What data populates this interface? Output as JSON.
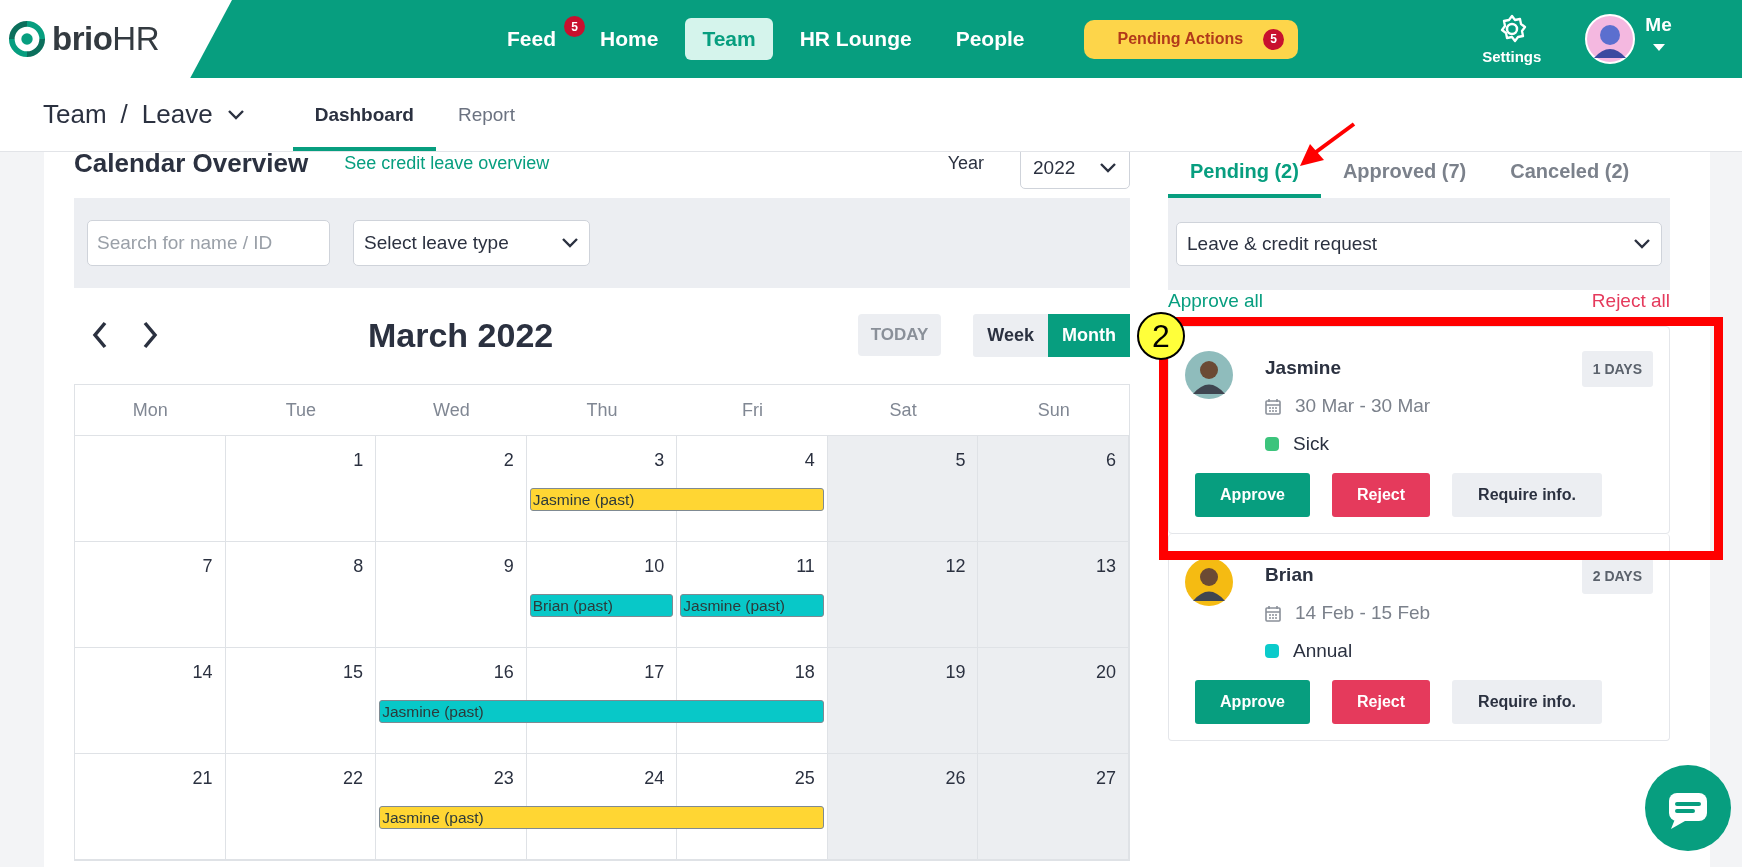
{
  "logo": {
    "text": "**brio**HR"
  },
  "nav": [
    {
      "kind": "link",
      "label": "Feed",
      "selected": false,
      "badge": "5"
    },
    {
      "kind": "link",
      "label": "Home",
      "selected": false
    },
    {
      "kind": "link",
      "label": "Team",
      "selected": true
    },
    {
      "kind": "link",
      "label": "HR Lounge",
      "selected": false
    },
    {
      "kind": "link",
      "label": "People",
      "selected": false
    },
    {
      "kind": "pill",
      "label": "Pending Actions",
      "selected": false,
      "badge": "5"
    }
  ],
  "settings": {
    "label": "Settings"
  },
  "profile": {
    "label": "Me"
  },
  "breadcrumb": {
    "section": "Team",
    "separator": "/",
    "page": "Leave"
  },
  "subtabs": [
    {
      "label": "Dashboard",
      "selected": true
    },
    {
      "label": "Report",
      "selected": false
    }
  ],
  "calendar": {
    "title": "Calendar Overview",
    "link": "See credit leave overview",
    "year_label": "Year",
    "year": "2022",
    "search": {
      "placeholder": "Search for name / ID"
    },
    "leave_type": {
      "value": "Select leave type"
    },
    "month": "March 2022",
    "today": "TODAY",
    "views": [
      {
        "label": "Week",
        "selected": false
      },
      {
        "label": "Month",
        "selected": true
      }
    ],
    "weekdays": [
      "Mon",
      "Tue",
      "Wed",
      "Thu",
      "Fri",
      "Sat",
      "Sun"
    ],
    "weeks": [
      {
        "days": [
          {
            "weekend": false
          },
          {
            "date": "1",
            "weekend": false
          },
          {
            "date": "2",
            "weekend": false
          },
          {
            "date": "3",
            "weekend": false,
            "event": {
              "label": "Jasmine (past)",
              "color": "#ffd633"
            }
          },
          {
            "date": "4",
            "weekend": false,
            "continues": true
          },
          {
            "date": "5",
            "weekend": true
          },
          {
            "date": "6",
            "weekend": true
          }
        ]
      },
      {
        "days": [
          {
            "date": "7",
            "weekend": false
          },
          {
            "date": "8",
            "weekend": false
          },
          {
            "date": "9",
            "weekend": false
          },
          {
            "date": "10",
            "weekend": false,
            "event": {
              "label": "Brian (past)",
              "color": "#08c8c8"
            }
          },
          {
            "date": "11",
            "weekend": false,
            "event": {
              "label": "Jasmine (past)",
              "color": "#08c8c8"
            }
          },
          {
            "date": "12",
            "weekend": true
          },
          {
            "date": "13",
            "weekend": true
          }
        ]
      },
      {
        "days": [
          {
            "date": "14",
            "weekend": false
          },
          {
            "date": "15",
            "weekend": false
          },
          {
            "date": "16",
            "weekend": false,
            "event": {
              "label": "Jasmine (past)",
              "color": "#08c8c8"
            }
          },
          {
            "date": "17",
            "weekend": false,
            "continues": true
          },
          {
            "date": "18",
            "weekend": false,
            "continues": true
          },
          {
            "date": "19",
            "weekend": true
          },
          {
            "date": "20",
            "weekend": true
          }
        ]
      },
      {
        "days": [
          {
            "date": "21",
            "weekend": false
          },
          {
            "date": "22",
            "weekend": false
          },
          {
            "date": "23",
            "weekend": false,
            "event": {
              "label": "Jasmine (past)",
              "color": "#ffd633"
            }
          },
          {
            "date": "24",
            "weekend": false,
            "continues": true
          },
          {
            "date": "25",
            "weekend": false,
            "continues": true
          },
          {
            "date": "26",
            "weekend": true
          },
          {
            "date": "27",
            "weekend": true
          }
        ]
      }
    ]
  },
  "requests": {
    "tabs": [
      {
        "label": "Pending (2)",
        "selected": true
      },
      {
        "label": "Approved (7)",
        "selected": false
      },
      {
        "label": "Canceled (2)",
        "selected": false
      }
    ],
    "filter": {
      "value": "Leave & credit request"
    },
    "approve_all": "Approve all",
    "reject_all": "Reject all",
    "items": [
      {
        "name": "Jasmine",
        "duration": "1 DAYS",
        "dates": "30 Mar - 30 Mar",
        "type": "Sick",
        "color": "#3cc47c",
        "highlighted": true,
        "actions": [
          "Approve",
          "Reject",
          "Require info."
        ]
      },
      {
        "name": "Brian",
        "duration": "2 DAYS",
        "dates": "14 Feb - 15 Feb",
        "type": "Annual",
        "color": "#0bcbcb",
        "highlighted": false,
        "actions": [
          "Approve",
          "Reject",
          "Require info."
        ]
      }
    ]
  },
  "annotation": {
    "marker": "2"
  }
}
